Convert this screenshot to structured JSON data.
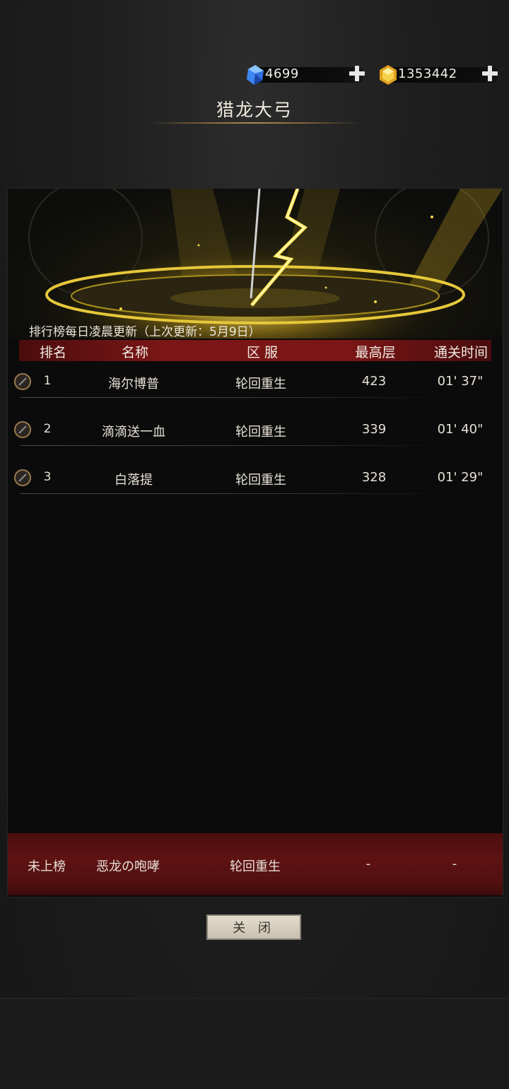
{
  "currency": {
    "diamond": {
      "value": "4699",
      "icon": "blue-diamond-icon"
    },
    "gold": {
      "value": "1353442",
      "icon": "gold-crystal-icon"
    }
  },
  "title": "猎龙大弓",
  "update_note": "排行榜每日凌晨更新（上次更新：5月9日）",
  "table": {
    "headers": [
      "排名",
      "名称",
      "区 服",
      "最高层",
      "通关时间"
    ],
    "rows": [
      {
        "rank": "1",
        "name": "海尔博普",
        "server": "轮回重生",
        "floor": "423",
        "time": "01' 37\""
      },
      {
        "rank": "2",
        "name": "滴滴送一血",
        "server": "轮回重生",
        "floor": "339",
        "time": "01' 40\""
      },
      {
        "rank": "3",
        "name": "白落提",
        "server": "轮回重生",
        "floor": "328",
        "time": "01' 29\""
      }
    ]
  },
  "my_rank": {
    "rank": "未上榜",
    "name": "恶龙の咆哮",
    "server": "轮回重生",
    "floor": "-",
    "time": "-"
  },
  "close_label": "关 闭",
  "colors": {
    "header_red": "#7a1616",
    "gold_glow": "#e8c020",
    "background": "#1b1b1b"
  }
}
